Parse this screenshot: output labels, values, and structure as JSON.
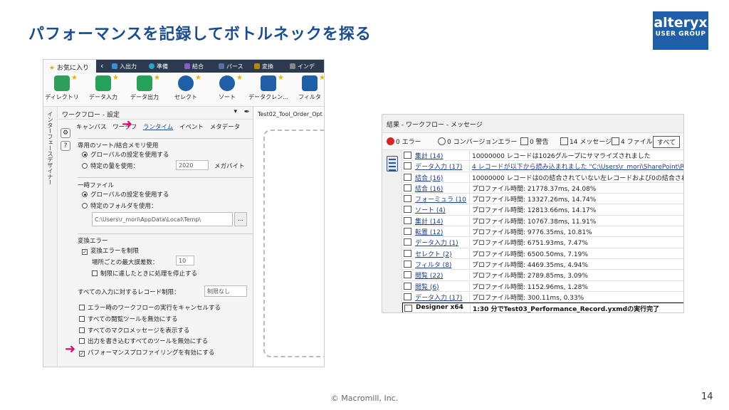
{
  "slide": {
    "title": "パフォーマンスを記録してボトルネックを探る",
    "logo_line1": "alteryx",
    "logo_line2": "USER GROUP",
    "footer": "© Macromill, Inc.",
    "page_number": "14"
  },
  "designer": {
    "favorites_tab": "お気に入り",
    "category_tabs": [
      "入出力",
      "準備",
      "結合",
      "パース",
      "変換",
      "インデ"
    ],
    "tools": [
      "ディレクトリ",
      "データ入力",
      "データ出力",
      "セレクト",
      "ソート",
      "データクレン...",
      "フィルタ"
    ],
    "vertical_tab": "インターフェースデザイナー",
    "panel_title": "ワークフロー - 設定",
    "panel_tabs": [
      "キャンバス",
      "ワークフ",
      "ランタイム",
      "イベント",
      "メタデータ"
    ],
    "active_tab": "ランタイム",
    "memory": {
      "title": "専用のソート/結合メモリ使用",
      "option1": "グローバルの設定を使用する",
      "option2": "特定の量を使用：",
      "amount": "2020",
      "unit": "メガバイト"
    },
    "temp": {
      "title": "一時ファイル",
      "option1": "グローバルの設定を使用する",
      "option2": "特定のフォルダを使用：",
      "path": "C:\\Users\\r_mori\\AppData\\Local\\Temp\\",
      "browse": "..."
    },
    "conversion": {
      "title": "変換エラー",
      "limit_label": "変換エラーを制限",
      "max_label": "場所ごとの最大誤差数：",
      "max_value": "10",
      "stop_label": "制限に達したときに処理を停止する"
    },
    "record_limit_label": "すべての入力に対するレコード制限：",
    "record_limit_placeholder": "制限なし",
    "checks": [
      "エラー時のワークフローの実行をキャンセルする",
      "すべての閲覧ツールを無効にする",
      "すべてのマクロメッセージを表示する",
      "出力を書き込むすべてのツールを無効にする",
      "パフォーマンスプロファイリングを有効にする"
    ],
    "canvas_tab": "Test02_Tool_Order_Opt"
  },
  "results": {
    "title": "結果 - ワークフロー - メッセージ",
    "filters": {
      "errors": "0 エラー",
      "conversion": "0 コンバージョンエラー",
      "warnings": "0 警告",
      "messages": "14 メッセージ",
      "files": "4 ファイル",
      "all": "すべて"
    },
    "rows": [
      {
        "tool": "集計 (14)",
        "text": "10000000 レコードは1026グループにサマライズされました"
      },
      {
        "tool": "データ入力 (17)",
        "text": "4 レコードが以下から読み込まれました \"C:\\Users\\r_mori\\SharePoint\\R"
      },
      {
        "tool": "結合 (16)",
        "text": "10000000 レコードは0の結合されていない左レコードおよび0の結合され"
      },
      {
        "tool": "結合 (16)",
        "text": "プロファイル時間: 21778.37ms, 24.08%"
      },
      {
        "tool": "フォーミュラ (10)",
        "text": "プロファイル時間: 13327.26ms, 14.74%"
      },
      {
        "tool": "ソート (4)",
        "text": "プロファイル時間: 12813.66ms, 14.17%"
      },
      {
        "tool": "集計 (14)",
        "text": "プロファイル時間: 10767.38ms, 11.91%"
      },
      {
        "tool": "転置 (12)",
        "text": "プロファイル時間: 9776.35ms, 10.81%"
      },
      {
        "tool": "データ入力 (1)",
        "text": "プロファイル時間: 6751.93ms, 7.47%"
      },
      {
        "tool": "セレクト (2)",
        "text": "プロファイル時間: 6500.50ms, 7.19%"
      },
      {
        "tool": "フィルタ (8)",
        "text": "プロファイル時間: 4469.35ms, 4.94%"
      },
      {
        "tool": "閲覧 (22)",
        "text": "プロファイル時間: 2789.85ms, 3.09%"
      },
      {
        "tool": "閲覧 (6)",
        "text": "プロファイル時間: 1152.96ms, 1.28%"
      },
      {
        "tool": "データ入力 (17)",
        "text": "プロファイル時間: 300.11ms, 0.33%"
      },
      {
        "tool": "Designer x64",
        "text": "1:30 分でTest03_Performance_Record.yxmdの実行完了"
      }
    ]
  },
  "colors": {
    "title": "#1a4d8f",
    "brand": "#1e5fa8",
    "highlight_arrow": "#e6007e",
    "tabbar": "#2b3a4e"
  }
}
